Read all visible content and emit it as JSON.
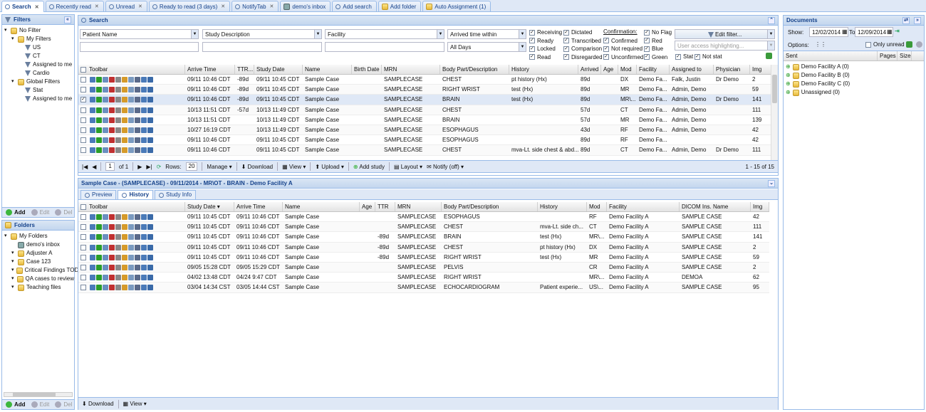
{
  "tabs": [
    {
      "label": "Search",
      "icon": "search-icon",
      "active": true
    },
    {
      "label": "Recently read",
      "icon": "search-icon"
    },
    {
      "label": "Unread",
      "icon": "search-icon"
    },
    {
      "label": "Ready to read (3 days)",
      "icon": "search-icon"
    },
    {
      "label": "NotifyTab",
      "icon": "search-icon"
    },
    {
      "label": "demo's inbox",
      "icon": "inbox-icon"
    },
    {
      "label": "Add search",
      "icon": "add-search-icon"
    },
    {
      "label": "Add folder",
      "icon": "folder-icon"
    },
    {
      "label": "Auto Assignment (1)",
      "icon": "assignment-icon"
    }
  ],
  "filters": {
    "title": "Filters",
    "nodes": [
      {
        "label": "No Filter",
        "level": 0,
        "type": "folder"
      },
      {
        "label": "My Filters",
        "level": 1,
        "type": "folder"
      },
      {
        "label": "US",
        "level": 2,
        "type": "filter"
      },
      {
        "label": "CT",
        "level": 2,
        "type": "filter"
      },
      {
        "label": "Assigned to me",
        "level": 2,
        "type": "filter"
      },
      {
        "label": "Cardio",
        "level": 2,
        "type": "filter"
      },
      {
        "label": "Global Filters",
        "level": 1,
        "type": "folder"
      },
      {
        "label": "Stat",
        "level": 2,
        "type": "filter"
      },
      {
        "label": "Assigned to me",
        "level": 2,
        "type": "filter"
      }
    ],
    "toolbar": {
      "add": "Add",
      "edit": "Edit",
      "del": "Del"
    }
  },
  "folders": {
    "title": "Folders",
    "nodes": [
      {
        "label": "My Folders",
        "level": 0,
        "type": "folder"
      },
      {
        "label": "demo's inbox",
        "level": 1,
        "type": "inbox"
      },
      {
        "label": "Adjuster A",
        "level": 1,
        "type": "folder"
      },
      {
        "label": "Case 123",
        "level": 1,
        "type": "folder"
      },
      {
        "label": "Critical Findings TOD",
        "level": 1,
        "type": "folder"
      },
      {
        "label": "QA cases to review",
        "level": 1,
        "type": "folder"
      },
      {
        "label": "Teaching files",
        "level": 1,
        "type": "folder"
      }
    ],
    "toolbar": {
      "add": "Add",
      "edit": "Edit",
      "del": "Del"
    }
  },
  "search": {
    "title": "Search",
    "patient_name": "Patient Name",
    "study_description": "Study Description",
    "facility": "Facility",
    "arrived_within": "Arrived time within",
    "all_days": "All Days",
    "status_col1": [
      {
        "label": "Receiving",
        "checked": true
      },
      {
        "label": "Ready",
        "checked": true
      },
      {
        "label": "Locked",
        "checked": true
      },
      {
        "label": "Read",
        "checked": true
      }
    ],
    "status_col2": [
      {
        "label": "Dictated",
        "checked": true
      },
      {
        "label": "Transcribed",
        "checked": true
      },
      {
        "label": "Comparison",
        "checked": true
      },
      {
        "label": "Disregarded",
        "checked": true
      }
    ],
    "confirmation_label": "Confirmation:",
    "confirmation": [
      {
        "label": "Confirmed",
        "checked": true
      },
      {
        "label": "Not required",
        "checked": true
      },
      {
        "label": "Unconfirmed",
        "checked": true
      }
    ],
    "flags": [
      {
        "label": "No Flag",
        "checked": true
      },
      {
        "label": "Red",
        "checked": true
      },
      {
        "label": "Blue",
        "checked": true
      },
      {
        "label": "Green",
        "checked": true
      }
    ],
    "edit_filter": "Edit filter...",
    "highlight_placeholder": "User access highlighting...",
    "stat": {
      "label": "Stat",
      "checked": true
    },
    "not_stat": {
      "label": "Not stat",
      "checked": true
    }
  },
  "results": {
    "columns": [
      "Toolbar",
      "Arrive Time",
      "TTR...",
      "Study Date",
      "Name",
      "Birth Date",
      "MRN",
      "Body Part/Description",
      "History",
      "Arrived",
      "Age",
      "Mod",
      "Facility",
      "Assigned to",
      "Physician",
      "Img"
    ],
    "rows": [
      {
        "checked": false,
        "arrive": "09/11 10:46 CDT",
        "ttr": "-89d",
        "study": "09/11 10:45 CDT",
        "name": "Sample Case",
        "birth": "",
        "mrn": "SAMPLECASE",
        "body": "CHEST",
        "history": "pt history (Hx)",
        "arrived": "89d",
        "age": "",
        "mod": "DX",
        "facility": "Demo Fa...",
        "assigned": "Falk, Justin",
        "physician": "Dr Demo",
        "img": "2"
      },
      {
        "checked": false,
        "arrive": "09/11 10:46 CDT",
        "ttr": "-89d",
        "study": "09/11 10:45 CDT",
        "name": "Sample Case",
        "birth": "",
        "mrn": "SAMPLECASE",
        "body": "RIGHT WRIST",
        "history": "test (Hx)",
        "arrived": "89d",
        "age": "",
        "mod": "MR",
        "facility": "Demo Fa...",
        "assigned": "Admin, Demo",
        "physician": "",
        "img": "59"
      },
      {
        "checked": true,
        "arrive": "09/11 10:46 CDT",
        "ttr": "-89d",
        "study": "09/11 10:45 CDT",
        "name": "Sample Case",
        "birth": "",
        "mrn": "SAMPLECASE",
        "body": "BRAIN",
        "history": "test (Hx)",
        "arrived": "89d",
        "age": "",
        "mod": "MR\\...",
        "facility": "Demo Fa...",
        "assigned": "Admin, Demo",
        "physician": "Dr Demo",
        "img": "141"
      },
      {
        "checked": false,
        "arrive": "10/13 11:51 CDT",
        "ttr": "-57d",
        "study": "10/13 11:49 CDT",
        "name": "Sample Case",
        "birth": "",
        "mrn": "SAMPLECASE",
        "body": "CHEST",
        "history": "",
        "arrived": "57d",
        "age": "",
        "mod": "CT",
        "facility": "Demo Fa...",
        "assigned": "Admin, Demo",
        "physician": "",
        "img": "111"
      },
      {
        "checked": false,
        "arrive": "10/13 11:51 CDT",
        "ttr": "",
        "study": "10/13 11:49 CDT",
        "name": "Sample Case",
        "birth": "",
        "mrn": "SAMPLECASE",
        "body": "BRAIN",
        "history": "",
        "arrived": "57d",
        "age": "",
        "mod": "MR",
        "facility": "Demo Fa...",
        "assigned": "Admin, Demo",
        "physician": "",
        "img": "139"
      },
      {
        "checked": false,
        "arrive": "10/27 16:19 CDT",
        "ttr": "",
        "study": "10/13 11:49 CDT",
        "name": "Sample Case",
        "birth": "",
        "mrn": "SAMPLECASE",
        "body": "ESOPHAGUS",
        "history": "",
        "arrived": "43d",
        "age": "",
        "mod": "RF",
        "facility": "Demo Fa...",
        "assigned": "Admin, Demo",
        "physician": "",
        "img": "42"
      },
      {
        "checked": false,
        "arrive": "09/11 10:46 CDT",
        "ttr": "",
        "study": "09/11 10:45 CDT",
        "name": "Sample Case",
        "birth": "",
        "mrn": "SAMPLECASE",
        "body": "ESOPHAGUS",
        "history": "",
        "arrived": "89d",
        "age": "",
        "mod": "RF",
        "facility": "Demo Fa...",
        "assigned": "",
        "physician": "",
        "img": "42"
      },
      {
        "checked": false,
        "arrive": "09/11 10:46 CDT",
        "ttr": "",
        "study": "09/11 10:45 CDT",
        "name": "Sample Case",
        "birth": "",
        "mrn": "SAMPLECASE",
        "body": "CHEST",
        "history": "mva-Lt. side chest & abd...",
        "arrived": "89d",
        "age": "",
        "mod": "CT",
        "facility": "Demo Fa...",
        "assigned": "Admin, Demo",
        "physician": "Dr Demo",
        "img": "111"
      }
    ]
  },
  "pager": {
    "page": "1",
    "of": "of 1",
    "rows_label": "Rows:",
    "rows_value": "20",
    "manage": "Manage",
    "download": "Download",
    "view": "View",
    "upload": "Upload",
    "add_study": "Add study",
    "layout": "Layout",
    "notify": "Notify (off)",
    "summary": "1 - 15 of 15"
  },
  "detail": {
    "title": "Sample Case - (SAMPLECASE) - 09/11/2014 - MR\\OT - BRAIN - Demo Facility A",
    "tabs": [
      {
        "label": "Preview"
      },
      {
        "label": "History",
        "active": true
      },
      {
        "label": "Study Info"
      }
    ],
    "columns": [
      "Toolbar",
      "Study Date",
      "Arrive Time",
      "Name",
      "Age",
      "TTR",
      "MRN",
      "Body Part/Description",
      "History",
      "Mod",
      "Facility",
      "DICOM Ins. Name",
      "Img"
    ],
    "rows": [
      {
        "study": "09/11 10:45 CDT",
        "arrive": "09/11 10:46 CDT",
        "name": "Sample Case",
        "age": "",
        "ttr": "",
        "mrn": "SAMPLECASE",
        "body": "ESOPHAGUS",
        "history": "",
        "mod": "RF",
        "facility": "Demo Facility A",
        "dicom": "SAMPLE CASE",
        "img": "42"
      },
      {
        "study": "09/11 10:45 CDT",
        "arrive": "09/11 10:46 CDT",
        "name": "Sample Case",
        "age": "",
        "ttr": "",
        "mrn": "SAMPLECASE",
        "body": "CHEST",
        "history": "mva-Lt. side ch...",
        "mod": "CT",
        "facility": "Demo Facility A",
        "dicom": "SAMPLE CASE",
        "img": "111"
      },
      {
        "study": "09/11 10:45 CDT",
        "arrive": "09/11 10:46 CDT",
        "name": "Sample Case",
        "age": "",
        "ttr": "-89d",
        "mrn": "SAMPLECASE",
        "body": "BRAIN",
        "history": "test (Hx)",
        "mod": "MR\\...",
        "facility": "Demo Facility A",
        "dicom": "SAMPLE CASE",
        "img": "141"
      },
      {
        "study": "09/11 10:45 CDT",
        "arrive": "09/11 10:46 CDT",
        "name": "Sample Case",
        "age": "",
        "ttr": "-89d",
        "mrn": "SAMPLECASE",
        "body": "CHEST",
        "history": "pt history (Hx)",
        "mod": "DX",
        "facility": "Demo Facility A",
        "dicom": "SAMPLE CASE",
        "img": "2"
      },
      {
        "study": "09/11 10:45 CDT",
        "arrive": "09/11 10:46 CDT",
        "name": "Sample Case",
        "age": "",
        "ttr": "-89d",
        "mrn": "SAMPLECASE",
        "body": "RIGHT WRIST",
        "history": "test (Hx)",
        "mod": "MR",
        "facility": "Demo Facility A",
        "dicom": "SAMPLE CASE",
        "img": "59"
      },
      {
        "study": "09/05 15:28 CDT",
        "arrive": "09/05 15:29 CDT",
        "name": "Sample Case",
        "age": "",
        "ttr": "",
        "mrn": "SAMPLECASE",
        "body": "PELVIS",
        "history": "",
        "mod": "CR",
        "facility": "Demo Facility A",
        "dicom": "SAMPLE CASE",
        "img": "2"
      },
      {
        "study": "04/02 13:48 CDT",
        "arrive": "04/24 9:47 CDT",
        "name": "Sample Case",
        "age": "",
        "ttr": "",
        "mrn": "SAMPLECASE",
        "body": "RIGHT WRIST",
        "history": "",
        "mod": "MR\\...",
        "facility": "Demo Facility A",
        "dicom": "DEMOA",
        "img": "62"
      },
      {
        "study": "03/04 14:34 CST",
        "arrive": "03/05 14:44 CST",
        "name": "Sample Case",
        "age": "",
        "ttr": "",
        "mrn": "SAMPLECASE",
        "body": "ECHOCARDIOGRAM",
        "history": "Patient experie...",
        "mod": "US\\...",
        "facility": "Demo Facility A",
        "dicom": "SAMPLE CASE",
        "img": "95"
      }
    ],
    "toolbar": {
      "download": "Download",
      "view": "View"
    }
  },
  "documents": {
    "title": "Documents",
    "show_label": "Show:",
    "from": "12/02/2014",
    "to_label": "To",
    "to": "12/09/2014",
    "options_label": "Options:",
    "only_unread": "Only unread",
    "columns": [
      "Sent",
      "Pages",
      "Size"
    ],
    "nodes": [
      "Demo Facility A (0)",
      "Demo Facility B (0)",
      "Demo Facility C (0)",
      "Unassigned (0)"
    ]
  }
}
